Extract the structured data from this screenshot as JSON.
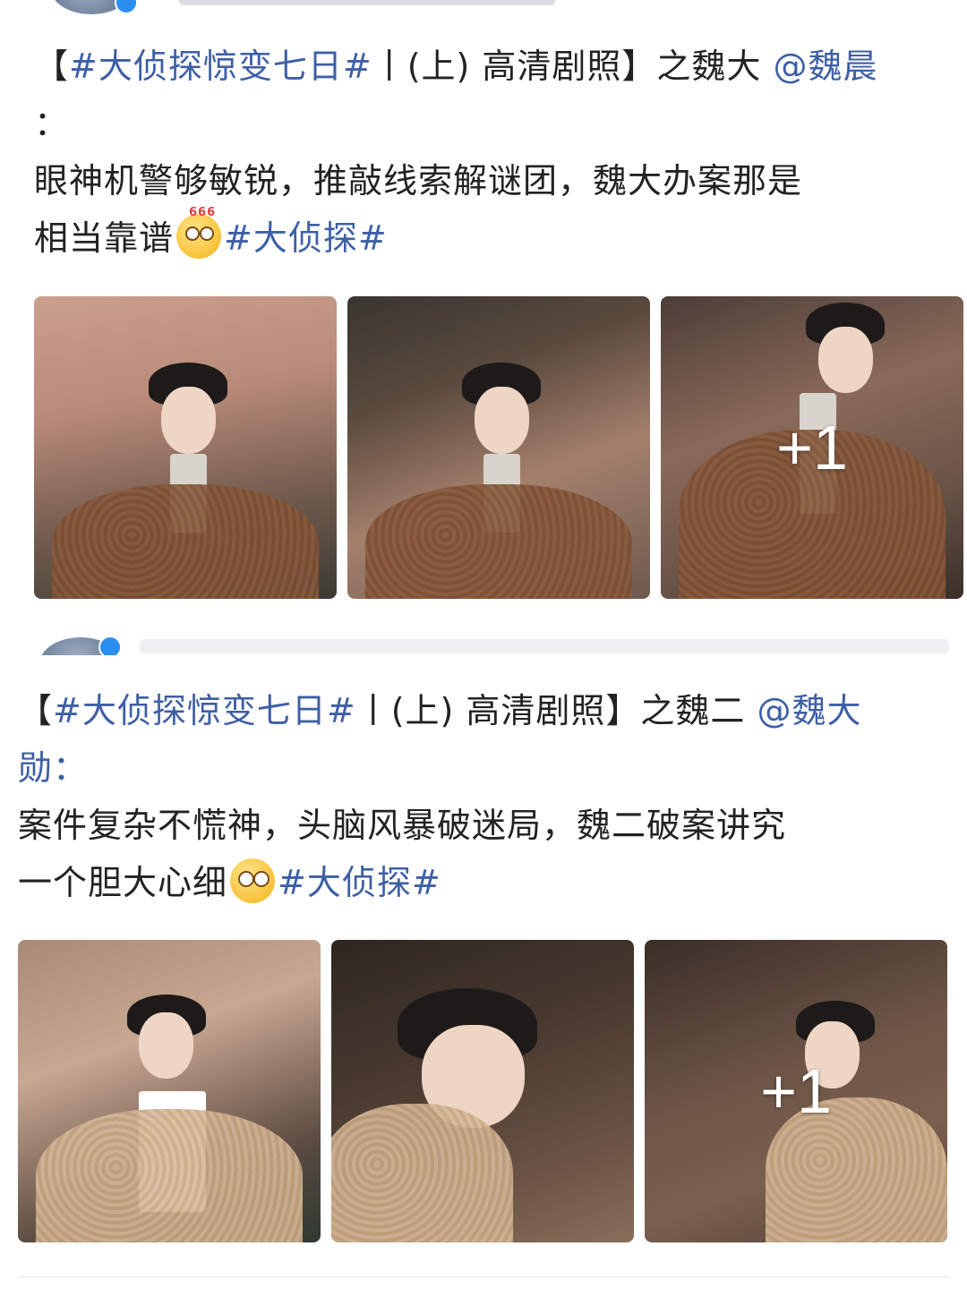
{
  "feed": {
    "posts": [
      {
        "author": {
          "verified": true
        },
        "text": {
          "line1": {
            "open": "【",
            "hashtag": "#大侦探惊变七日#",
            "middle": "丨(上) 高清剧照】之魏大 ",
            "mention": "@魏晨"
          },
          "line2": "：",
          "line3": "眼神机警够敏锐，推敲线索解谜团，魏大办案那是",
          "line4": {
            "prefix": "相当靠谱",
            "emoji": "666-emoji",
            "emoji_text": "666",
            "hashtag": "#大侦探#"
          }
        },
        "photos": [
          {
            "alt": "photo-1",
            "more": ""
          },
          {
            "alt": "photo-2",
            "more": ""
          },
          {
            "alt": "photo-3",
            "more": "+1"
          }
        ]
      },
      {
        "author": {
          "verified": true
        },
        "text": {
          "line1": {
            "open": "【",
            "hashtag": "#大侦探惊变七日#",
            "middle": "丨(上) 高清剧照】之魏二 ",
            "mention": "@魏大"
          },
          "line2": "勋：",
          "line3": "案件复杂不慌神，头脑风暴破迷局，魏二破案讲究",
          "line4": {
            "prefix": "一个胆大心细",
            "emoji": "thinking-emoji",
            "hashtag": "#大侦探#"
          }
        },
        "photos": [
          {
            "alt": "photo-1",
            "more": ""
          },
          {
            "alt": "photo-2",
            "more": ""
          },
          {
            "alt": "photo-3",
            "more": "+1"
          }
        ]
      }
    ]
  },
  "colors": {
    "link": "#3e5fa6",
    "text": "#222222",
    "verified": "#2d8ef2"
  }
}
